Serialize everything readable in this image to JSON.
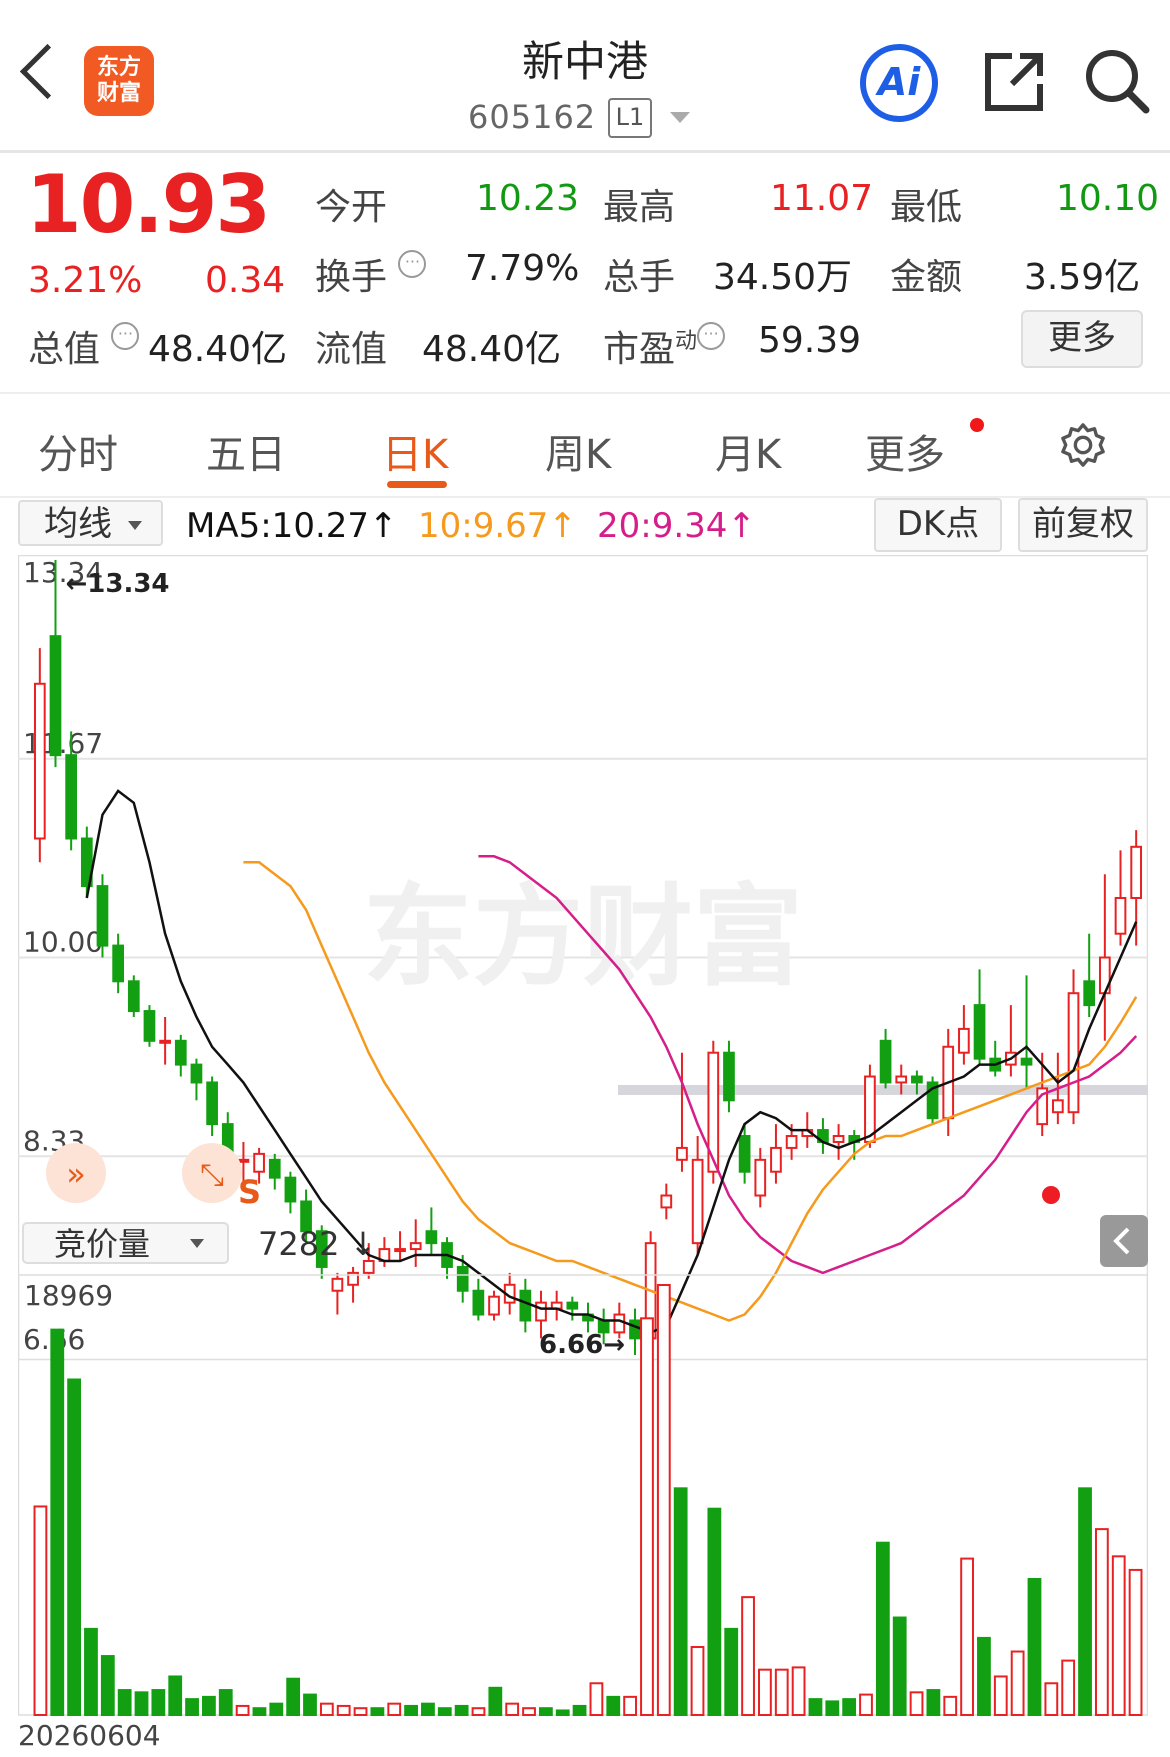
{
  "header": {
    "logo_line1": "东方",
    "logo_line2": "财富",
    "stock_name": "新中港",
    "stock_code": "605162",
    "level_badge": "L1",
    "ai_label": "Ai"
  },
  "quote": {
    "price": "10.93",
    "change_pct": "3.21%",
    "change_amt": "0.34",
    "open_label": "今开",
    "open": "10.23",
    "high_label": "最高",
    "high": "11.07",
    "low_label": "最低",
    "low": "10.10",
    "turnover_label": "换手",
    "turnover": "7.79%",
    "volume_label": "总手",
    "volume": "34.50万",
    "amount_label": "金额",
    "amount": "3.59亿",
    "mktcap_label": "总值",
    "mktcap": "48.40亿",
    "float_label": "流值",
    "float_cap": "48.40亿",
    "pe_label": "市盈",
    "pe_sup": "动",
    "pe": "59.39",
    "more_button": "更多"
  },
  "tabs": [
    {
      "label": "分时"
    },
    {
      "label": "五日"
    },
    {
      "label": "日K"
    },
    {
      "label": "周K"
    },
    {
      "label": "月K"
    },
    {
      "label": "更多"
    }
  ],
  "ma_bar": {
    "select_label": "均线",
    "ma5": "MA5:10.27↑",
    "ma10": "10:9.67↑",
    "ma20": "20:9.34↑",
    "dk_button": "DK点",
    "adjust_button": "前复权"
  },
  "chart": {
    "y_labels": [
      "13.34",
      "11.67",
      "10.00",
      "8.33",
      "6.66"
    ],
    "max_annotation": "←13.34",
    "min_annotation": "6.66→",
    "watermark": "东方财富",
    "s_marker": "S",
    "volume_select": "竞价量",
    "volume_value": "7282 ↓",
    "volume_max": "18969",
    "date_label": "20260604",
    "colors": {
      "up": "#e82222",
      "down": "#12a012",
      "ma5": "#111111",
      "ma10": "#f59a1c",
      "ma20": "#d61e8a"
    }
  },
  "chart_data": {
    "type": "candlestick",
    "ylim": [
      6.66,
      13.34
    ],
    "candles": [
      [
        11.0,
        12.3,
        10.8,
        12.6
      ],
      [
        12.7,
        11.7,
        11.6,
        13.34
      ],
      [
        11.7,
        11.0,
        10.9,
        11.9
      ],
      [
        11.0,
        10.6,
        10.5,
        11.1
      ],
      [
        10.6,
        10.1,
        10.0,
        10.7
      ],
      [
        10.1,
        9.8,
        9.7,
        10.2
      ],
      [
        9.8,
        9.55,
        9.5,
        9.85
      ],
      [
        9.55,
        9.3,
        9.25,
        9.6
      ],
      [
        9.3,
        9.3,
        9.1,
        9.5
      ],
      [
        9.3,
        9.1,
        9.0,
        9.35
      ],
      [
        9.1,
        8.95,
        8.8,
        9.15
      ],
      [
        8.95,
        8.6,
        8.5,
        9.0
      ],
      [
        8.6,
        8.3,
        8.2,
        8.7
      ],
      [
        8.3,
        8.3,
        8.1,
        8.45
      ],
      [
        8.2,
        8.35,
        8.1,
        8.4
      ],
      [
        8.3,
        8.15,
        8.05,
        8.35
      ],
      [
        8.15,
        7.95,
        7.85,
        8.2
      ],
      [
        7.95,
        7.7,
        7.6,
        8.05
      ],
      [
        7.7,
        7.4,
        7.3,
        7.75
      ],
      [
        7.2,
        7.3,
        7.0,
        7.35
      ],
      [
        7.25,
        7.35,
        7.1,
        7.4
      ],
      [
        7.35,
        7.45,
        7.3,
        7.6
      ],
      [
        7.45,
        7.55,
        7.4,
        7.65
      ],
      [
        7.55,
        7.55,
        7.45,
        7.7
      ],
      [
        7.55,
        7.6,
        7.4,
        7.8
      ],
      [
        7.7,
        7.6,
        7.5,
        7.9
      ],
      [
        7.6,
        7.4,
        7.3,
        7.65
      ],
      [
        7.4,
        7.2,
        7.1,
        7.5
      ],
      [
        7.2,
        7.0,
        6.95,
        7.3
      ],
      [
        7.0,
        7.15,
        6.95,
        7.2
      ],
      [
        7.1,
        7.25,
        7.0,
        7.35
      ],
      [
        7.2,
        6.95,
        6.85,
        7.3
      ],
      [
        6.95,
        7.1,
        6.8,
        7.2
      ],
      [
        7.05,
        7.1,
        6.95,
        7.2
      ],
      [
        7.1,
        7.05,
        6.95,
        7.15
      ],
      [
        7.0,
        6.95,
        6.85,
        7.1
      ],
      [
        6.95,
        6.85,
        6.75,
        7.05
      ],
      [
        6.85,
        7.0,
        6.8,
        7.1
      ],
      [
        6.95,
        6.8,
        6.66,
        7.05
      ],
      [
        6.8,
        7.6,
        6.75,
        7.7
      ],
      [
        7.9,
        8.0,
        7.8,
        8.1
      ],
      [
        8.3,
        8.4,
        8.2,
        9.2
      ],
      [
        7.6,
        8.3,
        7.5,
        8.5
      ],
      [
        8.2,
        9.2,
        8.1,
        9.3
      ],
      [
        9.2,
        8.8,
        8.7,
        9.3
      ],
      [
        8.5,
        8.2,
        8.1,
        8.6
      ],
      [
        8.0,
        8.3,
        7.9,
        8.4
      ],
      [
        8.2,
        8.4,
        8.1,
        8.6
      ],
      [
        8.4,
        8.5,
        8.3,
        8.6
      ],
      [
        8.5,
        8.55,
        8.4,
        8.7
      ],
      [
        8.55,
        8.45,
        8.35,
        8.65
      ],
      [
        8.45,
        8.5,
        8.3,
        8.6
      ],
      [
        8.5,
        8.45,
        8.3,
        8.55
      ],
      [
        8.45,
        9.0,
        8.4,
        9.1
      ],
      [
        9.3,
        8.95,
        8.9,
        9.4
      ],
      [
        8.95,
        9.0,
        8.85,
        9.1
      ],
      [
        9.0,
        8.95,
        8.85,
        9.05
      ],
      [
        8.95,
        8.65,
        8.6,
        9.0
      ],
      [
        8.65,
        9.25,
        8.5,
        9.4
      ],
      [
        9.2,
        9.4,
        9.1,
        9.6
      ],
      [
        9.6,
        9.15,
        9.1,
        9.9
      ],
      [
        9.15,
        9.05,
        9.0,
        9.3
      ],
      [
        9.1,
        9.2,
        9.0,
        9.6
      ],
      [
        9.15,
        9.1,
        8.9,
        9.85
      ],
      [
        8.6,
        8.9,
        8.5,
        9.2
      ],
      [
        8.7,
        8.8,
        8.6,
        9.2
      ],
      [
        8.7,
        9.7,
        8.6,
        9.9
      ],
      [
        9.8,
        9.6,
        9.5,
        10.2
      ],
      [
        9.7,
        10.0,
        9.3,
        10.7
      ],
      [
        10.2,
        10.5,
        10.1,
        10.9
      ],
      [
        10.5,
        10.93,
        10.1,
        11.07
      ]
    ],
    "ma5": [
      10.5,
      11.2,
      11.4,
      11.3,
      10.8,
      10.2,
      9.8,
      9.5,
      9.25,
      9.1,
      8.95,
      8.75,
      8.55,
      8.35,
      8.15,
      7.95,
      7.8,
      7.65,
      7.5,
      7.45,
      7.45,
      7.5,
      7.5,
      7.5,
      7.45,
      7.35,
      7.25,
      7.15,
      7.1,
      7.05,
      7.05,
      7.0,
      7.0,
      6.95,
      6.95,
      6.9,
      6.85,
      6.9,
      7.2,
      7.5,
      7.9,
      8.3,
      8.6,
      8.7,
      8.65,
      8.55,
      8.55,
      8.45,
      8.4,
      8.45,
      8.5,
      8.6,
      8.7,
      8.8,
      8.9,
      8.95,
      9.0,
      9.1,
      9.1,
      9.15,
      9.25,
      9.1,
      8.95,
      9.05,
      9.4,
      9.7,
      10.0,
      10.3
    ],
    "ma10": [
      10.8,
      10.8,
      10.7,
      10.6,
      10.4,
      10.1,
      9.8,
      9.5,
      9.2,
      8.95,
      8.75,
      8.55,
      8.35,
      8.15,
      7.95,
      7.8,
      7.7,
      7.6,
      7.55,
      7.5,
      7.45,
      7.45,
      7.4,
      7.35,
      7.3,
      7.25,
      7.2,
      7.15,
      7.1,
      7.05,
      7.0,
      6.95,
      7.0,
      7.15,
      7.35,
      7.6,
      7.85,
      8.05,
      8.2,
      8.35,
      8.45,
      8.5,
      8.5,
      8.55,
      8.6,
      8.65,
      8.7,
      8.75,
      8.8,
      8.85,
      8.9,
      8.95,
      9.0,
      9.05,
      9.1,
      9.25,
      9.45,
      9.67
    ],
    "ma20": [
      10.85,
      10.85,
      10.8,
      10.7,
      10.6,
      10.5,
      10.35,
      10.2,
      10.05,
      9.9,
      9.7,
      9.5,
      9.25,
      8.95,
      8.6,
      8.3,
      8.0,
      7.8,
      7.65,
      7.55,
      7.45,
      7.4,
      7.35,
      7.4,
      7.45,
      7.5,
      7.55,
      7.6,
      7.7,
      7.8,
      7.9,
      8.0,
      8.15,
      8.3,
      8.5,
      8.7,
      8.85,
      8.9,
      8.95,
      9.0,
      9.1,
      9.2,
      9.34
    ],
    "volume_max": 18969,
    "volumes": [
      [
        9200,
        1
      ],
      [
        17000,
        0
      ],
      [
        14800,
        0
      ],
      [
        3800,
        0
      ],
      [
        2600,
        0
      ],
      [
        1100,
        0
      ],
      [
        1000,
        0
      ],
      [
        1100,
        0
      ],
      [
        1700,
        0
      ],
      [
        700,
        0
      ],
      [
        800,
        0
      ],
      [
        1100,
        0
      ],
      [
        400,
        1
      ],
      [
        300,
        0
      ],
      [
        500,
        0
      ],
      [
        1600,
        0
      ],
      [
        900,
        0
      ],
      [
        500,
        1
      ],
      [
        400,
        1
      ],
      [
        300,
        1
      ],
      [
        300,
        0
      ],
      [
        500,
        1
      ],
      [
        400,
        0
      ],
      [
        500,
        0
      ],
      [
        300,
        0
      ],
      [
        400,
        0
      ],
      [
        300,
        1
      ],
      [
        1200,
        0
      ],
      [
        500,
        1
      ],
      [
        300,
        1
      ],
      [
        300,
        0
      ],
      [
        200,
        0
      ],
      [
        400,
        0
      ],
      [
        1400,
        1
      ],
      [
        800,
        0
      ],
      [
        800,
        1
      ],
      [
        17500,
        1
      ],
      [
        18969,
        1
      ],
      [
        10000,
        0
      ],
      [
        3000,
        1
      ],
      [
        9100,
        0
      ],
      [
        3800,
        0
      ],
      [
        5200,
        1
      ],
      [
        2000,
        1
      ],
      [
        2000,
        1
      ],
      [
        2100,
        1
      ],
      [
        700,
        0
      ],
      [
        600,
        0
      ],
      [
        700,
        0
      ],
      [
        900,
        1
      ],
      [
        7600,
        0
      ],
      [
        4300,
        0
      ],
      [
        1000,
        1
      ],
      [
        1100,
        0
      ],
      [
        800,
        1
      ],
      [
        6900,
        1
      ],
      [
        3400,
        0
      ],
      [
        1700,
        1
      ],
      [
        2800,
        1
      ],
      [
        6000,
        0
      ],
      [
        1400,
        1
      ],
      [
        2400,
        1
      ],
      [
        10000,
        0
      ],
      [
        8200,
        1
      ],
      [
        7000,
        1
      ],
      [
        6400,
        1
      ]
    ]
  }
}
